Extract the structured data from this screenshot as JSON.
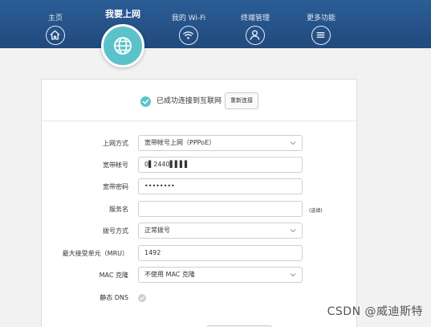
{
  "nav": {
    "items": [
      {
        "label": "主页",
        "icon": "home-icon"
      },
      {
        "label": "我要上网",
        "icon": "globe-icon"
      },
      {
        "label": "我的 Wi-Fi",
        "icon": "wifi-icon"
      },
      {
        "label": "终端管理",
        "icon": "user-icon"
      },
      {
        "label": "更多功能",
        "icon": "menu-icon"
      }
    ],
    "active_index": 1
  },
  "status": {
    "text": "已成功连接到互联网",
    "reconnect_label": "重新连接"
  },
  "form": {
    "mode": {
      "label": "上网方式",
      "value": "宽带帐号上网（PPPoE）"
    },
    "account": {
      "label": "宽带帐号",
      "value": "0▌2440▌▌▌▌"
    },
    "password": {
      "label": "宽带密码",
      "value": "••••••••"
    },
    "service": {
      "label": "服务名",
      "value": "",
      "hint": "(选填)"
    },
    "dial": {
      "label": "拨号方式",
      "value": "正常拨号"
    },
    "mru": {
      "label": "最大接受单元（MRU）",
      "value": "1492"
    },
    "mac": {
      "label": "MAC 克隆",
      "value": "不使用 MAC 克隆"
    },
    "dns": {
      "label": "静态 DNS"
    }
  },
  "colors": {
    "nav_bg": "#2b5d96",
    "accent": "#5cc2c9"
  },
  "watermark": "CSDN @威迪斯特"
}
